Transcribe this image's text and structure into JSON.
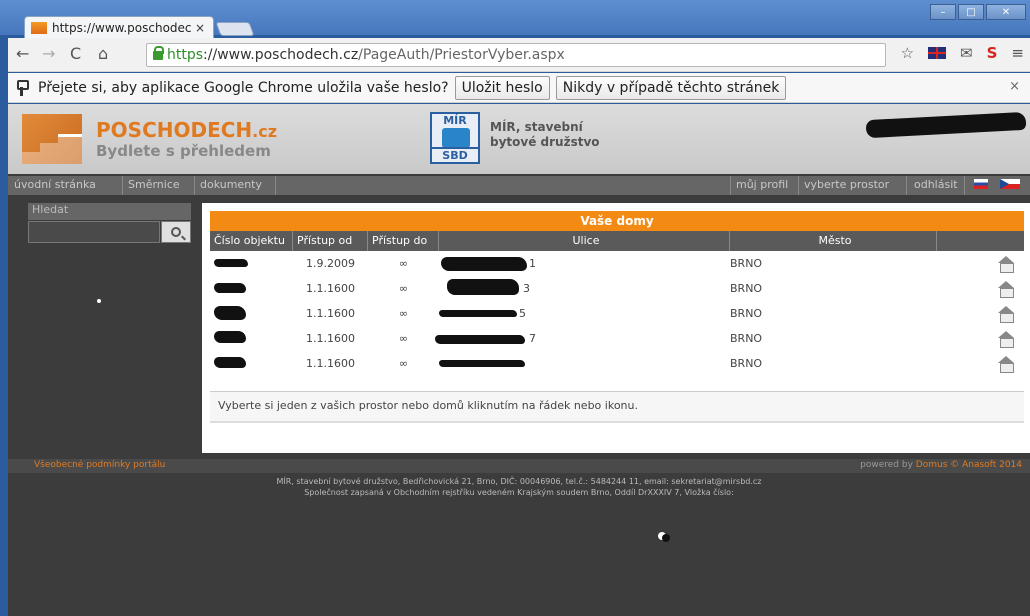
{
  "browser": {
    "tab_title": "https://www.poschodec",
    "tab_close": "×",
    "url_scheme": "https",
    "url_host": "://www.poschodech.cz",
    "url_path": "/PageAuth/PriestorVyber.aspx",
    "window_buttons": [
      "–",
      "□",
      "✕"
    ]
  },
  "infobar": {
    "message": "Přejete si, aby aplikace Google Chrome uložila vaše heslo?",
    "save_label": "Uložit heslo",
    "never_label": "Nikdy v případě těchto stránek",
    "close": "×"
  },
  "site": {
    "brand": "POSCHODECH",
    "brand_tld": ".cz",
    "tagline": "Bydlete s přehledem",
    "mir_top": "MÍR",
    "mir_bottom": "SBD",
    "coop_line1": "MÍR, stavební",
    "coop_line2": "bytové družstvo"
  },
  "nav": {
    "left": [
      "úvodní stránka",
      "Směrnice",
      "dokumenty"
    ],
    "right": [
      "můj profil",
      "vyberte prostor",
      "odhlásit"
    ]
  },
  "search": {
    "label": "Hledat"
  },
  "table": {
    "title": "Vaše domy",
    "headers": [
      "Číslo objektu",
      "Přístup od",
      "Přístup do",
      "Ulice",
      "Město",
      ""
    ],
    "rows": [
      {
        "from": "1.9.2009",
        "to": "∞",
        "street_suffix": "1",
        "city": "BRNO"
      },
      {
        "from": "1.1.1600",
        "to": "∞",
        "street_suffix": "3",
        "city": "BRNO"
      },
      {
        "from": "1.1.1600",
        "to": "∞",
        "street_suffix": "5",
        "city": "BRNO"
      },
      {
        "from": "1.1.1600",
        "to": "∞",
        "street_suffix": "7",
        "city": "BRNO"
      },
      {
        "from": "1.1.1600",
        "to": "∞",
        "street_suffix": "",
        "city": "BRNO"
      }
    ],
    "hint": "Vyberte si jeden z vašich prostor nebo domů kliknutím na řádek nebo ikonu."
  },
  "footer": {
    "left": "Všeobecné podmínky portálu",
    "powered_prefix": "powered by",
    "powered_name": "Domus © Anasoft 2014",
    "line1": "MÍR, stavební bytové družstvo, Bedřichovická 21, Brno, DIČ: 00046906, tel.č.: 5484244 11, email: sekretariat@mirsbd.cz",
    "line2": "Společnost zapsaná v Obchodním rejstříku vedeném Krajským soudem Brno, Oddíl DrXXXIV 7, Vložka číslo:"
  }
}
